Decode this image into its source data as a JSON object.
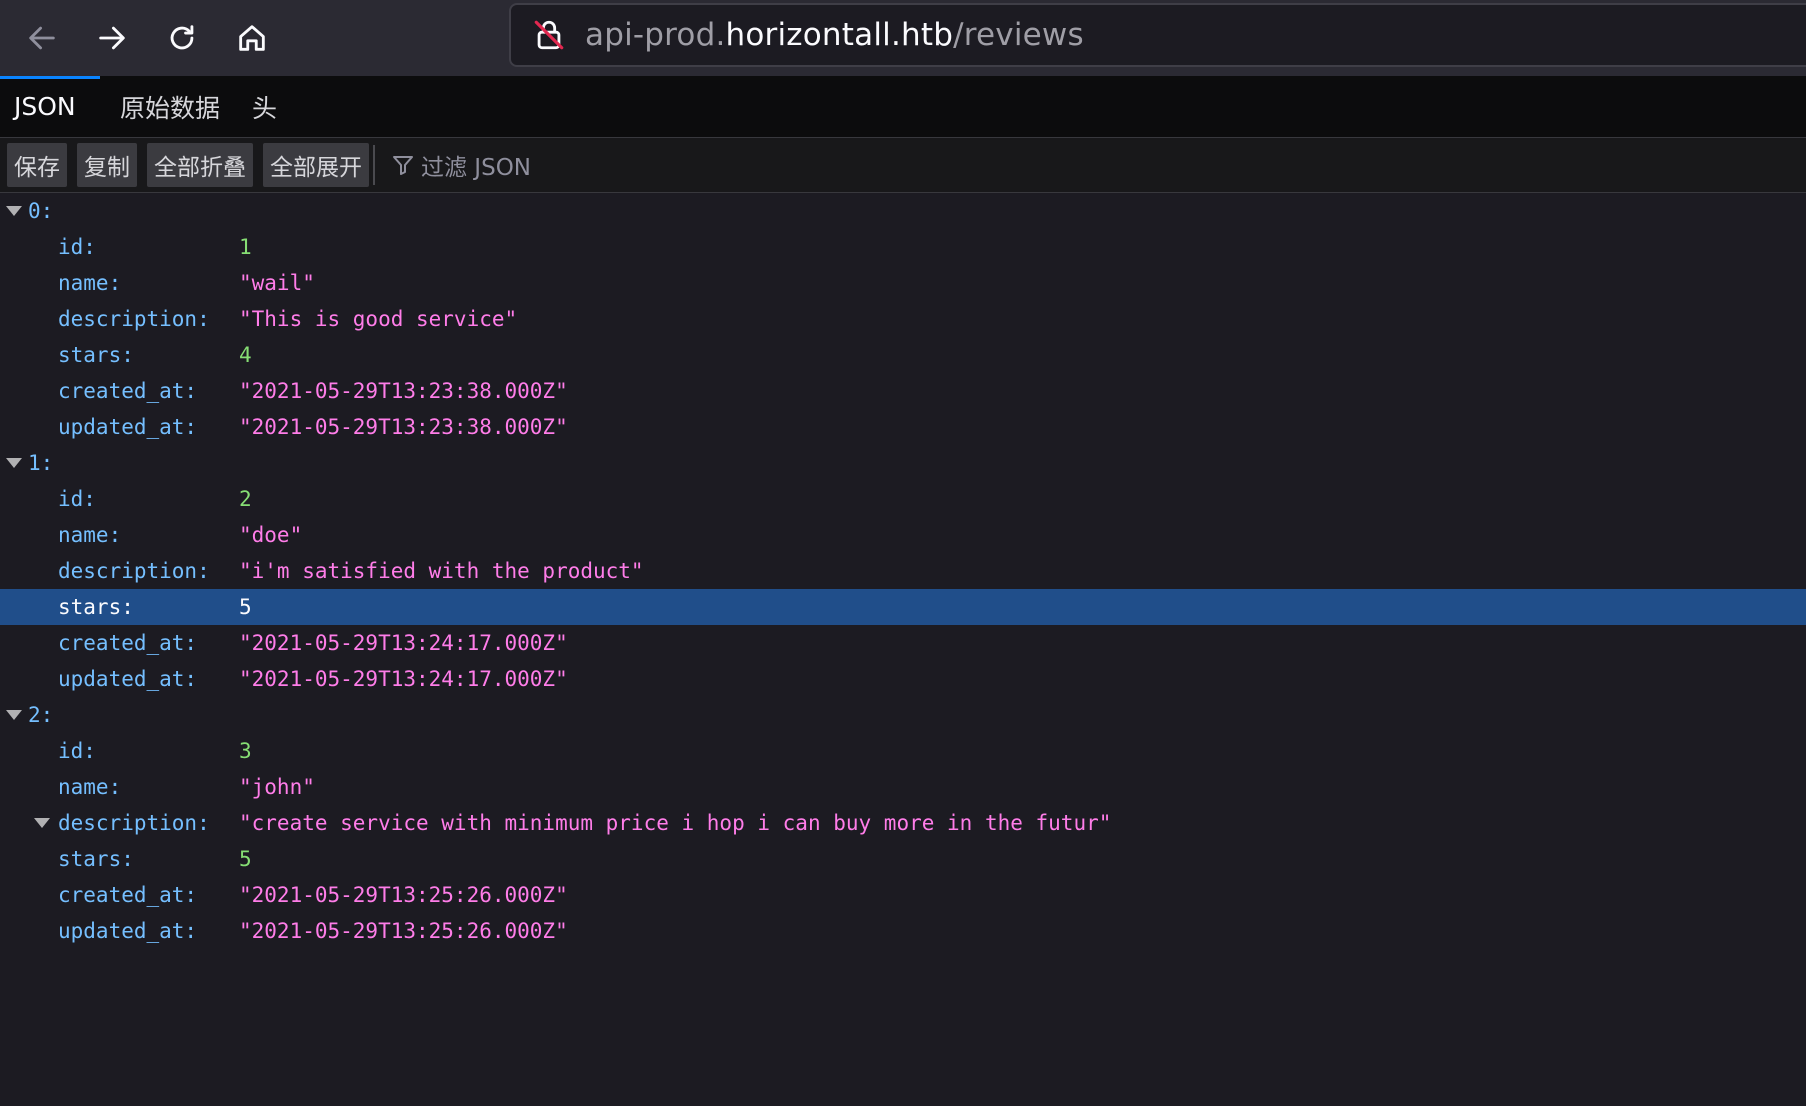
{
  "browser": {
    "url_prefix": "api-prod.",
    "url_host": "horizontall.htb",
    "url_path": "/reviews"
  },
  "tabs": [
    "JSON",
    "原始数据",
    "头"
  ],
  "toolbar": {
    "save": "保存",
    "copy": "复制",
    "collapse_all": "全部折叠",
    "expand_all": "全部展开",
    "filter_placeholder": "过滤 JSON"
  },
  "tree": [
    {
      "key": "0:",
      "props": [
        {
          "key": "id:",
          "value": "1",
          "type": "num"
        },
        {
          "key": "name:",
          "value": "\"wail\"",
          "type": "str"
        },
        {
          "key": "description:",
          "value": "\"This is good service\"",
          "type": "str"
        },
        {
          "key": "stars:",
          "value": "4",
          "type": "num"
        },
        {
          "key": "created_at:",
          "value": "\"2021-05-29T13:23:38.000Z\"",
          "type": "str"
        },
        {
          "key": "updated_at:",
          "value": "\"2021-05-29T13:23:38.000Z\"",
          "type": "str"
        }
      ]
    },
    {
      "key": "1:",
      "props": [
        {
          "key": "id:",
          "value": "2",
          "type": "num"
        },
        {
          "key": "name:",
          "value": "\"doe\"",
          "type": "str"
        },
        {
          "key": "description:",
          "value": "\"i'm satisfied with the product\"",
          "type": "str"
        },
        {
          "key": "stars:",
          "value": "5",
          "type": "num",
          "selected": true
        },
        {
          "key": "created_at:",
          "value": "\"2021-05-29T13:24:17.000Z\"",
          "type": "str"
        },
        {
          "key": "updated_at:",
          "value": "\"2021-05-29T13:24:17.000Z\"",
          "type": "str"
        }
      ]
    },
    {
      "key": "2:",
      "props": [
        {
          "key": "id:",
          "value": "3",
          "type": "num"
        },
        {
          "key": "name:",
          "value": "\"john\"",
          "type": "str"
        },
        {
          "key": "description:",
          "value": "\"create service with minimum price i hop i can buy more in the futur\"",
          "type": "str",
          "expandable": true
        },
        {
          "key": "stars:",
          "value": "5",
          "type": "num"
        },
        {
          "key": "created_at:",
          "value": "\"2021-05-29T13:25:26.000Z\"",
          "type": "str"
        },
        {
          "key": "updated_at:",
          "value": "\"2021-05-29T13:25:26.000Z\"",
          "type": "str"
        }
      ]
    }
  ]
}
